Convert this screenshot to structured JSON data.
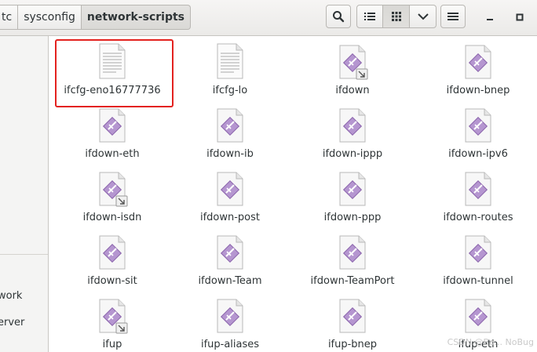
{
  "breadcrumb": [
    "tc",
    "sysconfig",
    "network-scripts"
  ],
  "sidebar": {
    "items": [
      "work",
      "erver"
    ]
  },
  "files": [
    {
      "name": "ifcfg-eno16777736",
      "icon": "text-file-icon"
    },
    {
      "name": "ifcfg-lo",
      "icon": "text-file-icon"
    },
    {
      "name": "ifdown",
      "icon": "script-link-icon"
    },
    {
      "name": "ifdown-bnep",
      "icon": "script-icon"
    },
    {
      "name": "ifdown-eth",
      "icon": "script-icon"
    },
    {
      "name": "ifdown-ib",
      "icon": "script-icon"
    },
    {
      "name": "ifdown-ippp",
      "icon": "script-icon"
    },
    {
      "name": "ifdown-ipv6",
      "icon": "script-icon"
    },
    {
      "name": "ifdown-isdn",
      "icon": "script-link-icon"
    },
    {
      "name": "ifdown-post",
      "icon": "script-icon"
    },
    {
      "name": "ifdown-ppp",
      "icon": "script-icon"
    },
    {
      "name": "ifdown-routes",
      "icon": "script-icon"
    },
    {
      "name": "ifdown-sit",
      "icon": "script-icon"
    },
    {
      "name": "ifdown-Team",
      "icon": "script-icon"
    },
    {
      "name": "ifdown-TeamPort",
      "icon": "script-icon"
    },
    {
      "name": "ifdown-tunnel",
      "icon": "script-icon"
    },
    {
      "name": "ifup",
      "icon": "script-link-icon"
    },
    {
      "name": "ifup-aliases",
      "icon": "script-icon"
    },
    {
      "name": "ifup-bnep",
      "icon": "script-icon"
    },
    {
      "name": "ifup-eth",
      "icon": "script-icon"
    }
  ],
  "watermark": "CSDN @Bo... NoBug",
  "colors": {
    "selection": "#e3221f",
    "script_purple": "#9b6fbd"
  }
}
